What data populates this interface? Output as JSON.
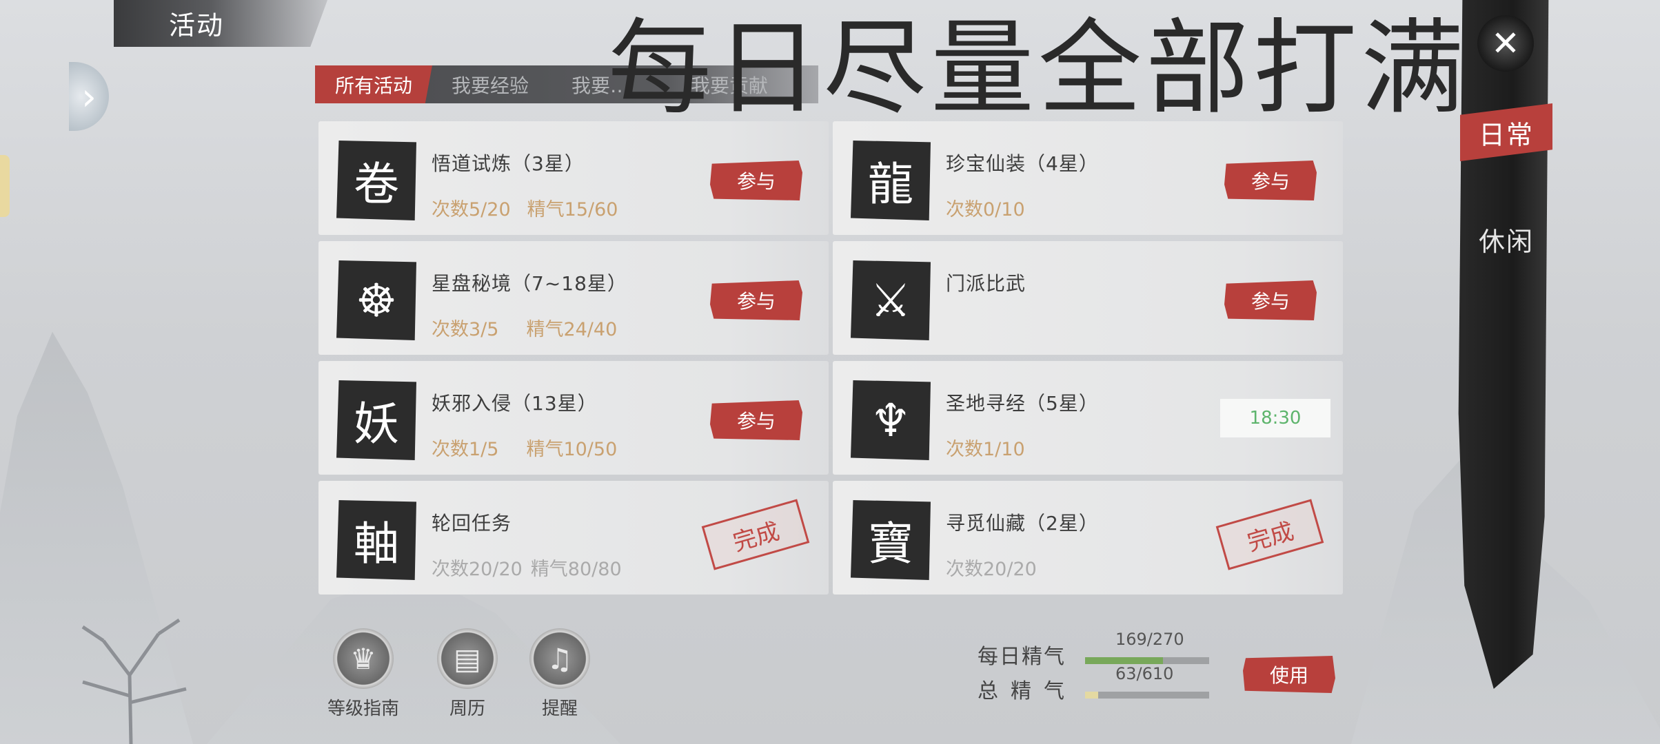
{
  "header": {
    "title": "活动"
  },
  "overlay_text": "每日尽量全部打满",
  "tabs": [
    {
      "label": "所有活动"
    },
    {
      "label": "我要经验"
    },
    {
      "label": "我要…"
    },
    {
      "label": "我要贡献"
    }
  ],
  "activities": [
    {
      "name": "悟道试炼（3星）",
      "count": "次数5/20",
      "energy": "精气15/60",
      "action": "参与",
      "icon": "scroll-icon",
      "icon_glyph": "卷"
    },
    {
      "name": "珍宝仙装（4星）",
      "count": "次数0/10",
      "energy": "",
      "action": "参与",
      "icon": "dragon-icon",
      "icon_glyph": "龍"
    },
    {
      "name": "星盘秘境（7~18星）",
      "count": "次数3/5",
      "energy": "精气24/40",
      "action": "参与",
      "icon": "star-chart-icon",
      "icon_glyph": "☸"
    },
    {
      "name": "门派比武",
      "count": "",
      "energy": "",
      "action": "参与",
      "icon": "crossed-swords-shield-icon",
      "icon_glyph": "⚔"
    },
    {
      "name": "妖邪入侵（13星）",
      "count": "次数1/5",
      "energy": "精气10/50",
      "action": "参与",
      "icon": "demon-hat-icon",
      "icon_glyph": "妖"
    },
    {
      "name": "圣地寻经（5星）",
      "count": "次数1/10",
      "energy": "",
      "time": "18:30",
      "icon": "sword-emblem-icon",
      "icon_glyph": "♆"
    },
    {
      "name": "轮回任务",
      "count": "次数20/20",
      "energy": "精气80/80",
      "stamp": "完成",
      "icon": "scroll-bundle-icon",
      "icon_glyph": "軸"
    },
    {
      "name": "寻觅仙藏（2星）",
      "count": "次数20/20",
      "energy": "",
      "stamp": "完成",
      "icon": "treasure-ingot-icon",
      "icon_glyph": "寶"
    }
  ],
  "bottom_buttons": [
    {
      "label": "等级指南",
      "icon": "badge-icon",
      "glyph": "♛"
    },
    {
      "label": "周历",
      "icon": "calendar-icon",
      "glyph": "▤"
    },
    {
      "label": "提醒",
      "icon": "bell-icon",
      "glyph": "♫"
    }
  ],
  "energy": {
    "daily_label": "每日精气",
    "daily_value": "169/270",
    "daily_fraction": 0.626,
    "total_label": "总精气",
    "total_value": "63/610",
    "total_fraction": 0.103,
    "use_label": "使用"
  },
  "right_panel": {
    "close_glyph": "✕",
    "tabs": [
      {
        "label": "日常"
      },
      {
        "label": "休闲"
      }
    ]
  }
}
